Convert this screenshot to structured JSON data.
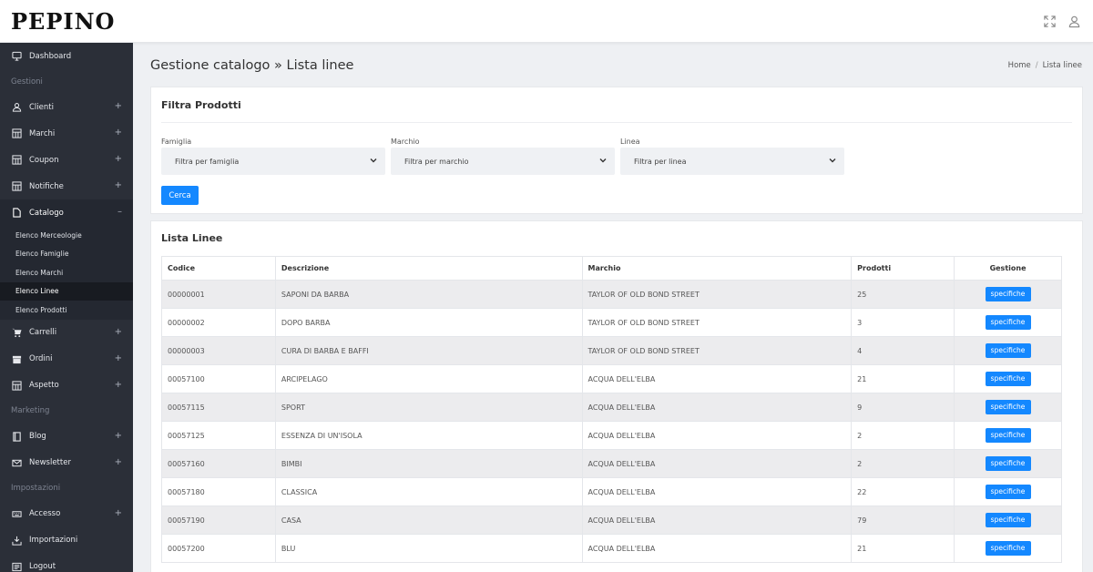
{
  "brand": "PEPINO",
  "topbar": {
    "icons": [
      "expand-icon",
      "user-icon"
    ]
  },
  "sidebar": {
    "items": [
      {
        "label": "Dashboard",
        "icon": "monitor-icon",
        "expandable": false
      },
      {
        "section": "Gestioni"
      },
      {
        "label": "Clienti",
        "icon": "user-icon",
        "expandable": true,
        "toggle": "+"
      },
      {
        "label": "Marchi",
        "icon": "grid-icon",
        "expandable": true,
        "toggle": "+"
      },
      {
        "label": "Coupon",
        "icon": "grid-icon",
        "expandable": true,
        "toggle": "+"
      },
      {
        "label": "Notifiche",
        "icon": "grid-icon",
        "expandable": true,
        "toggle": "+"
      },
      {
        "label": "Catalogo",
        "icon": "document-icon",
        "expandable": true,
        "toggle": "–",
        "open": true,
        "children": [
          "Elenco Merceologie",
          "Elenco Famiglie",
          "Elenco Marchi",
          "Elenco Linee",
          "Elenco Prodotti"
        ],
        "active_child": "Elenco Linee"
      },
      {
        "label": "Carrelli",
        "icon": "cart-icon",
        "expandable": true,
        "toggle": "+"
      },
      {
        "label": "Ordini",
        "icon": "box-icon",
        "expandable": true,
        "toggle": "+"
      },
      {
        "label": "Aspetto",
        "icon": "grid-icon",
        "expandable": true,
        "toggle": "+"
      },
      {
        "section": "Marketing"
      },
      {
        "label": "Blog",
        "icon": "book-icon",
        "expandable": true,
        "toggle": "+"
      },
      {
        "label": "Newsletter",
        "icon": "mail-icon",
        "expandable": true,
        "toggle": "+"
      },
      {
        "section": "Impostazioni"
      },
      {
        "label": "Accesso",
        "icon": "keyboard-icon",
        "expandable": true,
        "toggle": "+"
      },
      {
        "label": "Importazioni",
        "icon": "import-icon",
        "expandable": false
      },
      {
        "label": "Logout",
        "icon": "logout-icon",
        "expandable": false
      }
    ]
  },
  "page": {
    "title": "Gestione catalogo » Lista linee",
    "breadcrumb": {
      "home": "Home",
      "sep": "/",
      "current": "Lista linee"
    }
  },
  "filter": {
    "title": "Filtra Prodotti",
    "fields": [
      {
        "label": "Famiglia",
        "placeholder": "Filtra per famiglia"
      },
      {
        "label": "Marchio",
        "placeholder": "Filtra per marchio"
      },
      {
        "label": "Linea",
        "placeholder": "Filtra per linea"
      }
    ],
    "search_label": "Cerca"
  },
  "list": {
    "title": "Lista Linee",
    "columns": [
      "Codice",
      "Descrizione",
      "Marchio",
      "Prodotti",
      "Gestione"
    ],
    "action_label": "specifiche",
    "rows": [
      {
        "codice": "00000001",
        "descrizione": "SAPONI DA BARBA",
        "marchio": "TAYLOR OF OLD BOND STREET",
        "prodotti": "25"
      },
      {
        "codice": "00000002",
        "descrizione": "DOPO BARBA",
        "marchio": "TAYLOR OF OLD BOND STREET",
        "prodotti": "3"
      },
      {
        "codice": "00000003",
        "descrizione": "CURA DI BARBA E BAFFI",
        "marchio": "TAYLOR OF OLD BOND STREET",
        "prodotti": "4"
      },
      {
        "codice": "00057100",
        "descrizione": "ARCIPELAGO",
        "marchio": "ACQUA DELL'ELBA",
        "prodotti": "21"
      },
      {
        "codice": "00057115",
        "descrizione": "SPORT",
        "marchio": "ACQUA DELL'ELBA",
        "prodotti": "9"
      },
      {
        "codice": "00057125",
        "descrizione": "ESSENZA DI UN'ISOLA",
        "marchio": "ACQUA DELL'ELBA",
        "prodotti": "2"
      },
      {
        "codice": "00057160",
        "descrizione": "BIMBI",
        "marchio": "ACQUA DELL'ELBA",
        "prodotti": "2"
      },
      {
        "codice": "00057180",
        "descrizione": "CLASSICA",
        "marchio": "ACQUA DELL'ELBA",
        "prodotti": "22"
      },
      {
        "codice": "00057190",
        "descrizione": "CASA",
        "marchio": "ACQUA DELL'ELBA",
        "prodotti": "79"
      },
      {
        "codice": "00057200",
        "descrizione": "BLU",
        "marchio": "ACQUA DELL'ELBA",
        "prodotti": "21"
      }
    ]
  },
  "colors": {
    "primary": "#1488ff",
    "sidebar": "#2b2f38",
    "sidebar_open": "#242831",
    "row_stripe": "#ececee"
  }
}
